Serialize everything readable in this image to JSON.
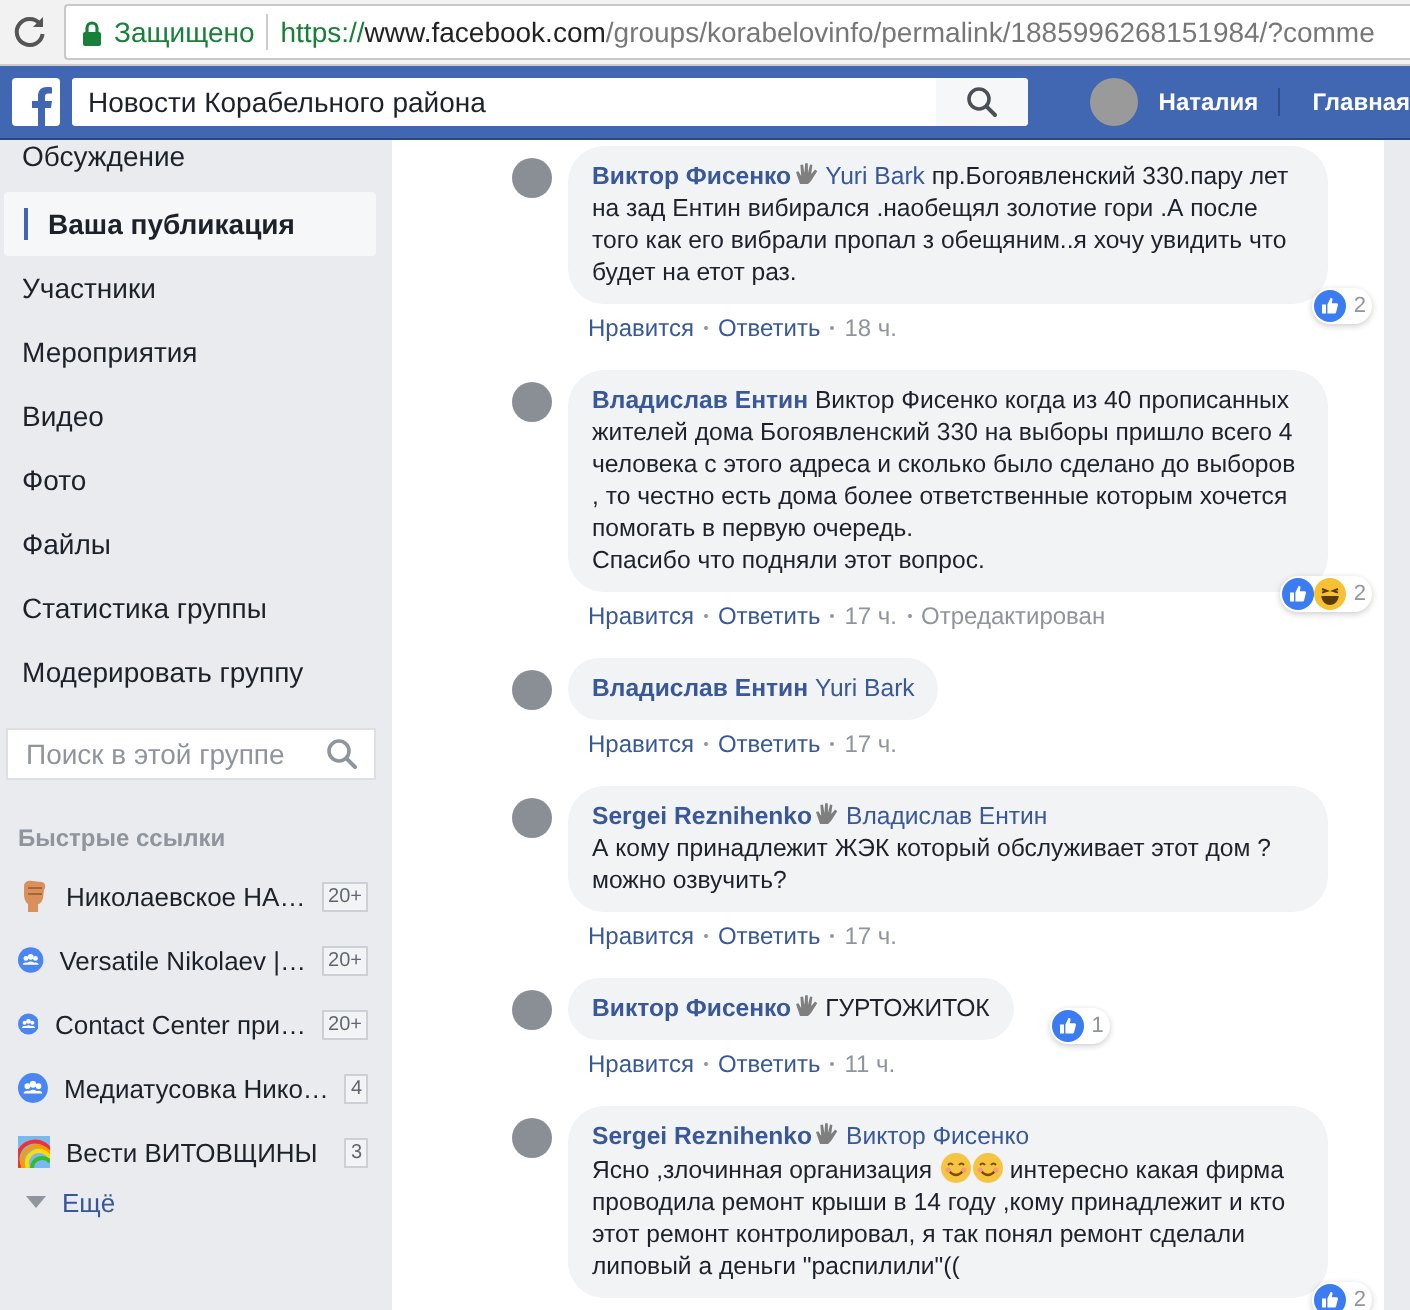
{
  "browser": {
    "security_label": "Защищено",
    "url_scheme": "https://",
    "url_host": "www.facebook.com",
    "url_path": "/groups/korabelovinfo/permalink/1885996268151984/?comme"
  },
  "topbar": {
    "search_value": "Новости Корабельного района",
    "user_name": "Наталия",
    "home_link": "Главная"
  },
  "sidebar": {
    "items": [
      {
        "label": "Обсуждение",
        "selected": false
      },
      {
        "label": "Ваша публикация",
        "selected": true
      },
      {
        "label": "Участники",
        "selected": false
      },
      {
        "label": "Мероприятия",
        "selected": false
      },
      {
        "label": "Видео",
        "selected": false
      },
      {
        "label": "Фото",
        "selected": false
      },
      {
        "label": "Файлы",
        "selected": false
      },
      {
        "label": "Статистика группы",
        "selected": false
      },
      {
        "label": "Модерировать группу",
        "selected": false
      }
    ],
    "search": {
      "placeholder": "Поиск в этой группе"
    },
    "shortcuts_title": "Быстрые ссылки",
    "shortcuts": [
      {
        "kind": "fist",
        "label": "Николаевское НА…",
        "count": "20+"
      },
      {
        "kind": "group",
        "label": "Versatile Nikolaev |…",
        "count": "20+"
      },
      {
        "kind": "group",
        "label": "Contact Center при…",
        "count": "20+"
      },
      {
        "kind": "group",
        "label": "Медиатусовка Нико…",
        "count": "4"
      },
      {
        "kind": "rainbow",
        "label": "Вести ВИТОВЩИНЫ",
        "count": "3"
      }
    ],
    "more_label": "Ещё"
  },
  "comments": [
    {
      "author": "Виктор Фисенко",
      "waved": true,
      "mention": "Yuri Bark",
      "body_newline": false,
      "body": [
        {
          "kind": "text",
          "text": "пр.Богоявленский 330.пару лет на зад Ентин вибирался .наобещял золотие гори .А после того как его вибрали пропал з обещяним..я хочу увидить что будет на етот раз."
        }
      ],
      "reactions": {
        "icons": [
          {
            "kind": "like"
          }
        ],
        "count": "2"
      },
      "actions": [
        {
          "kind": "link",
          "text": "Нравится"
        },
        {
          "kind": "link",
          "text": "Ответить"
        },
        {
          "kind": "time",
          "text": "18 ч."
        }
      ]
    },
    {
      "author": "Владислав Ентин",
      "waved": false,
      "body_newline": false,
      "body": [
        {
          "kind": "text",
          "text": "Виктор Фисенко когда из 40 прописанных жителей дома Богоявленский 330 на выборы пришло всего 4 человека с этого адреса и сколько было сделано до выборов , то честно есть дома более ответственные которым хочется помогать в первую очередь.\nСпасибо что подняли этот вопрос."
        }
      ],
      "reactions": {
        "icons": [
          {
            "kind": "like"
          },
          {
            "kind": "haha"
          }
        ],
        "count": "2"
      },
      "actions": [
        {
          "kind": "link",
          "text": "Нравится"
        },
        {
          "kind": "link",
          "text": "Ответить"
        },
        {
          "kind": "time",
          "text": "17 ч."
        },
        {
          "kind": "note",
          "text": "Отредактирован"
        }
      ]
    },
    {
      "author": "Владислав Ентин",
      "waved": false,
      "mention": "Yuri Bark",
      "actions": [
        {
          "kind": "link",
          "text": "Нравится"
        },
        {
          "kind": "link",
          "text": "Ответить"
        },
        {
          "kind": "time",
          "text": "17 ч."
        }
      ]
    },
    {
      "author": "Sergei Reznihenko",
      "waved": true,
      "mention": "Владислав Ентин",
      "body_newline": true,
      "body": [
        {
          "kind": "text",
          "text": "А кому принадлежит ЖЭК который обслуживает этот дом ?можно озвучить?"
        }
      ],
      "actions": [
        {
          "kind": "link",
          "text": "Нравится"
        },
        {
          "kind": "link",
          "text": "Ответить"
        },
        {
          "kind": "time",
          "text": "17 ч."
        }
      ]
    },
    {
      "author": "Виктор Фисенко",
      "waved": true,
      "body_newline": false,
      "body": [
        {
          "kind": "text",
          "text": "ГУРТОЖИТОК"
        }
      ],
      "reactions": {
        "icons": [
          {
            "kind": "like"
          }
        ],
        "count": "1"
      },
      "actions": [
        {
          "kind": "link",
          "text": "Нравится"
        },
        {
          "kind": "link",
          "text": "Ответить"
        },
        {
          "kind": "time",
          "text": "11 ч."
        }
      ]
    },
    {
      "author": "Sergei Reznihenko",
      "waved": true,
      "mention": "Виктор Фисенко",
      "body_newline": true,
      "body": [
        {
          "kind": "text",
          "text": "Ясно ,злочинная организация "
        },
        {
          "kind": "emoji"
        },
        {
          "kind": "emoji"
        },
        {
          "kind": "text",
          "text": " интересно какая фирма проводила ремонт крыши в 14 году ,кому принадлежит и кто этот ремонт контролировал, я так понял ремонт сделали липовый а деньги \"распилили\"(("
        }
      ],
      "reactions": {
        "icons": [
          {
            "kind": "like"
          }
        ],
        "count": "2"
      }
    }
  ]
}
